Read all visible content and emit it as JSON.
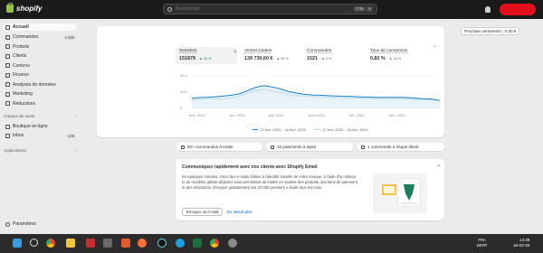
{
  "app": {
    "logo_text": "shopify"
  },
  "topbar": {
    "search_placeholder": "Rechercher",
    "shortcut_1": "CTRL",
    "shortcut_2": "K"
  },
  "sidebar": {
    "items": [
      {
        "label": "Accueil",
        "icon": "home-icon",
        "active": true
      },
      {
        "label": "Commandes",
        "icon": "inbox-icon",
        "badge": "4 365"
      },
      {
        "label": "Produits",
        "icon": "tag-icon"
      },
      {
        "label": "Clients",
        "icon": "person-icon"
      },
      {
        "label": "Contenu",
        "icon": "content-icon"
      },
      {
        "label": "Finance",
        "icon": "bank-icon"
      },
      {
        "label": "Analyses de données",
        "icon": "chart-icon"
      },
      {
        "label": "Marketing",
        "icon": "target-icon"
      },
      {
        "label": "Réductions",
        "icon": "discount-icon"
      }
    ],
    "sales_channels": {
      "heading": "Canaux de vente",
      "items": [
        {
          "label": "Boutique en ligne",
          "icon": "store-icon"
        },
        {
          "label": "Inbox",
          "badge": "449"
        }
      ]
    },
    "apps_heading": "Applications",
    "settings_label": "Paramètres"
  },
  "filters": {
    "date_range": "365 derniers jours",
    "channels": "Tous les canaux",
    "payout": "Prochain versement : 0,00 €"
  },
  "metrics": [
    {
      "label": "Sessions",
      "value": "151879",
      "change": "▲ 34 %"
    },
    {
      "label": "Ventes totales",
      "value": "139 730,60 €",
      "change": "▲ 35 %"
    },
    {
      "label": "Commandes",
      "value": "1521",
      "change": "▲ 9 %"
    },
    {
      "label": "Taux de conversion",
      "value": "0,82 %",
      "change": "▲ 18 %"
    }
  ],
  "chart_data": {
    "type": "line",
    "y_ticks": [
      "40 k",
      "20 k",
      "0"
    ],
    "ylim": [
      0,
      40000
    ],
    "categories": [
      "févr. 2024",
      "avr. 2024",
      "juin 2024",
      "août 2024",
      "oct. 2024",
      "déc. 2024"
    ],
    "series": [
      {
        "name": "17 févr. 2024 – 16 févr. 2025",
        "style": "solid",
        "color": "#1f7fc4",
        "values": [
          12500,
          13300,
          13800,
          14500,
          15200,
          16300,
          18000,
          22000,
          26000,
          28000,
          26500,
          24300,
          21000,
          19000,
          17500,
          16600,
          16200,
          15700,
          15300,
          15000,
          14700,
          14200,
          13900,
          13700,
          13600,
          13600,
          13700,
          13300,
          12400,
          11900,
          11600,
          9800
        ]
      },
      {
        "name": "17 févr. 2023 – 16 févr. 2024",
        "style": "dotted",
        "color": "#85c4e8",
        "values": [
          10900,
          11100,
          11600,
          11900,
          12100,
          13000,
          15100,
          19100,
          22000,
          23600,
          21700,
          19500,
          17100,
          15800,
          15200,
          14600,
          14000,
          13600,
          13200,
          13000,
          12900,
          12500,
          12300,
          12100,
          12000,
          11900,
          12000,
          11700,
          11200,
          10800,
          10500,
          10000
        ]
      }
    ]
  },
  "tasks": [
    {
      "label": "50+ commandes à traiter",
      "icon": "inbox-icon"
    },
    {
      "label": "15 paiements à saisir",
      "icon": "payment-icon"
    },
    {
      "label": "1 commande à risque élevé",
      "icon": "alert-icon"
    }
  ],
  "email_card": {
    "title": "Communiquez rapidement avec vos clients avec Shopify Email",
    "body": "En quelques minutes, créez des e-mails fidèles à l'identité visuelle de votre marque, à l'aide d'un éditeur et de modèles glisser-déposer vous permettant de mettre en vedette des produits, des liens de paiement et des réductions. Envoyez gratuitement vos 10 000 premiers e-mails tous les mois.",
    "primary_button": "Envoyer un e-mail",
    "secondary_link": "En savoir plus"
  },
  "taskbar": {
    "lang_1": "FRA",
    "lang_2": "BEFR",
    "time": "14:38",
    "date": "16-02-25",
    "icons": [
      "windows-icon",
      "search-icon",
      "chrome-icon",
      "file-explorer-icon",
      "app-icon",
      "firefox-icon",
      "tiktok-icon",
      "edge-icon",
      "excel-icon",
      "chrome-icon",
      "settings-icon"
    ]
  }
}
